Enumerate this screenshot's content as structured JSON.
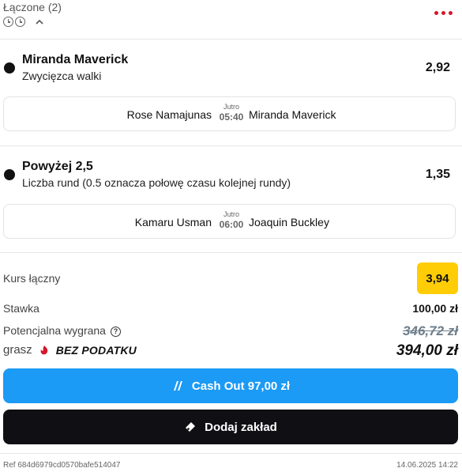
{
  "header": {
    "title": "Łączone (2)",
    "icons": [
      "clock-icon",
      "clock-icon",
      "chevron-up-icon"
    ],
    "menu_icon": "more-dots-icon"
  },
  "selections": [
    {
      "name": "Miranda Maverick",
      "market": "Zwycięzca walki",
      "odds": "2,92",
      "sport_icon": "mma-glove-icon",
      "event": {
        "home": "Rose Namajunas",
        "day": "Jutro",
        "time": "05:40",
        "away": "Miranda Maverick"
      }
    },
    {
      "name": "Powyżej 2,5",
      "market": "Liczba rund (0.5 oznacza połowę czasu kolejnej rundy)",
      "odds": "1,35",
      "sport_icon": "mma-glove-icon",
      "event": {
        "home": "Kamaru Usman",
        "day": "Jutro",
        "time": "06:00",
        "away": "Joaquin Buckley"
      }
    }
  ],
  "summary": {
    "kurs_label": "Kurs łączny",
    "kurs_value": "3,94",
    "stake_label": "Stawka",
    "stake_value": "100,00 zł",
    "potential_label": "Potencjalna wygrana",
    "potential_old": "346,72 zł",
    "grasz_label": "grasz",
    "brand": "BEZ PODATKU",
    "potential_new": "394,00 zł"
  },
  "buttons": {
    "cashout": "Cash Out 97,00 zł",
    "add_bet": "Dodaj zakład"
  },
  "footer": {
    "ref": "Ref 684d6979cd0570bafe514047",
    "timestamp": "14.06.2025 14:22"
  },
  "colors": {
    "accent_red": "#d6162b",
    "odds_badge": "#ffcd05",
    "cashout_blue": "#1b9af6",
    "dark_button": "#0f0f14"
  }
}
